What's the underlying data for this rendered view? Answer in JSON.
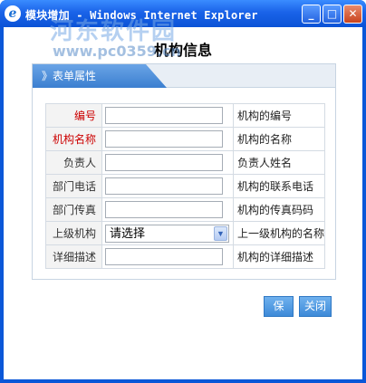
{
  "window": {
    "title": "模块增加 - Windows Internet Explorer",
    "icon": "ie-icon",
    "controls": {
      "minimize": "_",
      "maximize": "□",
      "close": "✕"
    }
  },
  "watermark": {
    "line1": "河东软件园",
    "line2": "www.pc0359.cn"
  },
  "page": {
    "title": "机构信息",
    "panel_tab": "》表单属性"
  },
  "form": {
    "rows": [
      {
        "label": "编号",
        "required": true,
        "value": "",
        "desc": "机构的编号"
      },
      {
        "label": "机构名称",
        "required": true,
        "value": "",
        "desc": "机构的名称"
      },
      {
        "label": "负责人",
        "required": false,
        "value": "",
        "desc": "负责人姓名"
      },
      {
        "label": "部门电话",
        "required": false,
        "value": "",
        "desc": "机构的联系电话"
      },
      {
        "label": "部门传真",
        "required": false,
        "value": "",
        "desc": "机构的传真码码"
      },
      {
        "label": "上级机构",
        "required": false,
        "value": "请选择",
        "desc": "上一级机构的名称"
      },
      {
        "label": "详细描述",
        "required": false,
        "value": "",
        "desc": "机构的详细描述"
      }
    ]
  },
  "buttons": {
    "save": "保存",
    "close": "关闭"
  },
  "colors": {
    "titlebar": "#1a63e8",
    "required_label": "#cc0000",
    "button": "#3d8ad8"
  }
}
